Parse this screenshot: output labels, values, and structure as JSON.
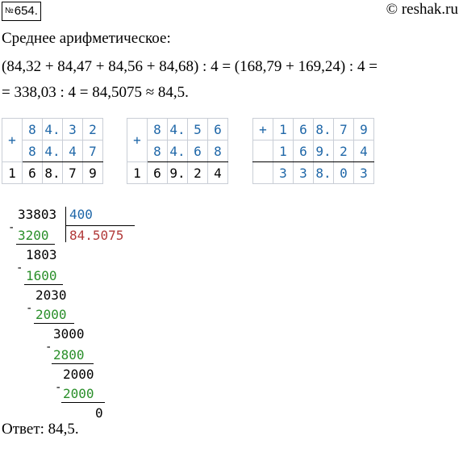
{
  "header": {
    "number_prefix": "№",
    "number": "654.",
    "site": "© reshak.ru"
  },
  "text": {
    "line1": "Среднее арифметическое:",
    "line2": "(84,32 + 84,47 + 84,56 + 84,68) : 4 = (168,79 + 169,24) : 4 =",
    "line3": "= 338,03 : 4 = 84,5075 ≈ 84,5."
  },
  "additions": [
    {
      "op": "+",
      "row1": [
        "8",
        "4.",
        "3",
        "2"
      ],
      "row2": [
        "8",
        "4.",
        "4",
        "7"
      ],
      "sum": [
        "1",
        "6",
        "8.",
        "7",
        "9"
      ]
    },
    {
      "op": "+",
      "row1": [
        "8",
        "4.",
        "5",
        "6"
      ],
      "row2": [
        "8",
        "4.",
        "6",
        "8"
      ],
      "sum": [
        "1",
        "6",
        "9.",
        "2",
        "4"
      ]
    },
    {
      "op": "+",
      "row1": [
        "1",
        "6",
        "8.",
        "7",
        "9"
      ],
      "row2": [
        "1",
        "6",
        "9.",
        "2",
        "4"
      ],
      "sum": [
        "3",
        "3",
        "8.",
        "0",
        "3"
      ]
    }
  ],
  "division": {
    "dividend": "33803",
    "divisor": "400",
    "quotient": "84.5075",
    "steps": [
      {
        "sub": "3200",
        "rem": "1803"
      },
      {
        "sub": "1600",
        "rem": "2030"
      },
      {
        "sub": "2000",
        "rem": "3000"
      },
      {
        "sub": "2800",
        "rem": "2000"
      },
      {
        "sub": "2000",
        "rem": "0"
      }
    ],
    "minus": "-"
  },
  "answer": "Ответ: 84,5."
}
